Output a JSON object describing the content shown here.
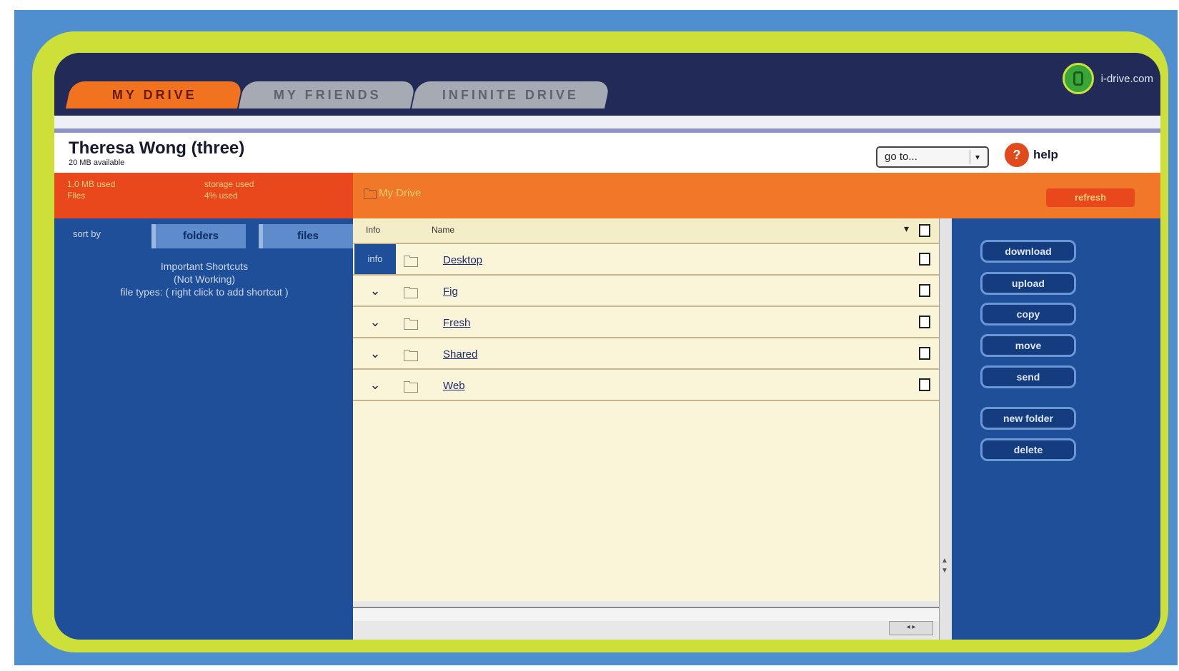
{
  "tabs": [
    {
      "label": "MY DRIVE",
      "active": true
    },
    {
      "label": "MY FRIENDS",
      "active": false
    },
    {
      "label": "INFINITE DRIVE",
      "active": false
    }
  ],
  "brand": {
    "label": "i-drive.com",
    "logo_icon": "drive-logo-icon"
  },
  "user": {
    "name": "Theresa Wong (three)",
    "subtitle": "20 MB available"
  },
  "goto": {
    "value": "go to..."
  },
  "help": {
    "label": "help",
    "icon": "help-icon"
  },
  "stats": {
    "a": "1.0 MB used\nFiles",
    "b": "storage used\n4% used"
  },
  "path": {
    "label": "My Drive"
  },
  "refresh_label": "refresh",
  "sort": {
    "label": "sort by",
    "buttons": [
      "folders",
      "files"
    ]
  },
  "favorites": {
    "title": "Important Shortcuts",
    "line1": "(Not Working)",
    "line2": "file types: ( right click to add shortcut )"
  },
  "list": {
    "columns": {
      "info": "Info",
      "name": "Name"
    },
    "rows": [
      {
        "info": "info",
        "selected": true,
        "icon": "folder-icon",
        "name": "Desktop"
      },
      {
        "info": "⌄",
        "selected": false,
        "icon": "folder-icon",
        "name": "Fig"
      },
      {
        "info": "⌄",
        "selected": false,
        "icon": "folder-icon",
        "name": "Fresh"
      },
      {
        "info": "⌄",
        "selected": false,
        "icon": "folder-icon",
        "name": "Shared"
      },
      {
        "info": "⌄",
        "selected": false,
        "icon": "folder-icon",
        "name": "Web"
      }
    ]
  },
  "actions": [
    "download",
    "upload",
    "copy",
    "move",
    "send",
    "new folder",
    "delete"
  ],
  "colors": {
    "frame_green": "#cde03a",
    "panel_blue": "#1e4f98",
    "tab_orange": "#f2731f",
    "list_bg": "#faf5d8"
  }
}
